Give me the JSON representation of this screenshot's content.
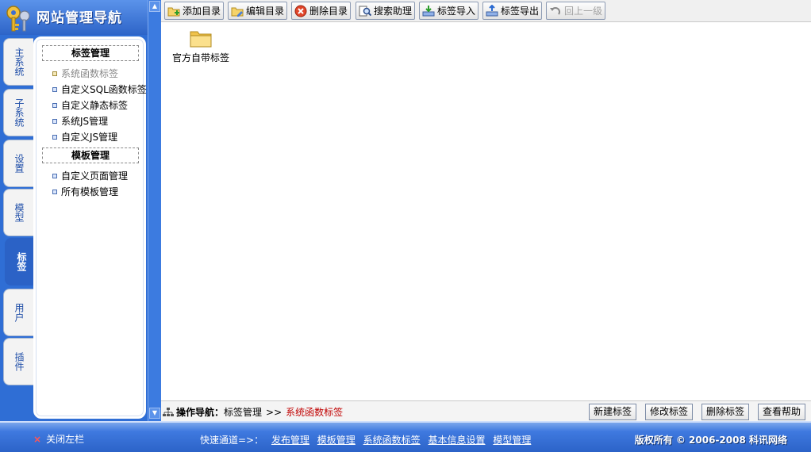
{
  "header": {
    "title": "网站管理导航"
  },
  "tabs": [
    {
      "label": "主系统",
      "active": false
    },
    {
      "label": "子系统",
      "active": false
    },
    {
      "label": "设置",
      "active": false
    },
    {
      "label": "模型",
      "active": false
    },
    {
      "label": "标签",
      "active": true
    },
    {
      "label": "用户",
      "active": false
    },
    {
      "label": "插件",
      "active": false
    }
  ],
  "menu": {
    "section1": {
      "title": "标签管理",
      "items": [
        {
          "label": "系统函数标签",
          "dim": true
        },
        {
          "label": "自定义SQL函数标签"
        },
        {
          "label": "自定义静态标签"
        },
        {
          "label": "系统JS管理"
        },
        {
          "label": "自定义JS管理"
        }
      ]
    },
    "section2": {
      "title": "模板管理",
      "items": [
        {
          "label": "自定义页面管理"
        },
        {
          "label": "所有模板管理"
        }
      ]
    }
  },
  "toolbar": {
    "add_dir": "添加目录",
    "edit_dir": "编辑目录",
    "delete_dir": "删除目录",
    "search": "搜索助理",
    "import": "标签导入",
    "export": "标签导出",
    "up": "回上一级",
    "up_disabled": true
  },
  "content": {
    "folder_label": "官方自带标签"
  },
  "breadcrumb": {
    "prefix": "操作导航：",
    "path": "标签管理",
    "separator": ">>",
    "current": "系统函数标签"
  },
  "actions": {
    "new": "新建标签",
    "edit": "修改标签",
    "delete": "删除标签",
    "help": "查看帮助"
  },
  "footer": {
    "close_left": "关闭左栏",
    "quick_label": "快速通道=>：",
    "quick_links": [
      "发布管理",
      "模板管理",
      "系统函数标签",
      "基本信息设置",
      "模型管理"
    ],
    "copyright": "版权所有 © 2006-2008 科讯网络"
  },
  "colors": {
    "accent": "#2f6ed5",
    "current_crumb": "#c00000"
  }
}
